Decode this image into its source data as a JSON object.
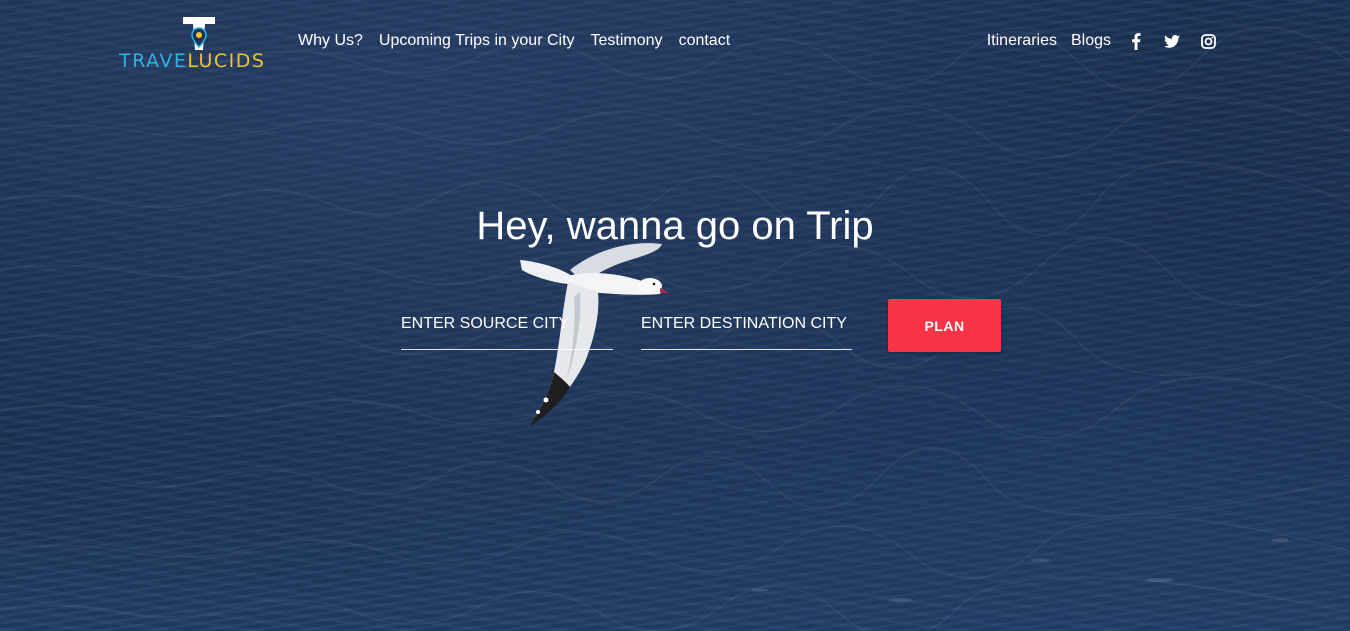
{
  "brand": {
    "logo_text_a": "TRAVE",
    "logo_text_b": "LUCIDS",
    "colors": {
      "cyan": "#2cb2e6",
      "yellow": "#f2c12e"
    }
  },
  "nav": {
    "left_links": [
      {
        "label": "Why Us?"
      },
      {
        "label": "Upcoming Trips in your City"
      },
      {
        "label": "Testimony"
      },
      {
        "label": "contact"
      }
    ],
    "right_links": [
      {
        "label": "Itineraries"
      },
      {
        "label": "Blogs"
      }
    ],
    "social_icons": [
      "facebook-icon",
      "twitter-icon",
      "instagram-icon"
    ]
  },
  "hero": {
    "headline": "Hey, wanna go on Trip",
    "source_placeholder": "ENTER SOURCE CITY",
    "destination_placeholder": "ENTER DESTINATION CITY",
    "plan_label": "PLAN",
    "accent_color": "#fb3347"
  }
}
